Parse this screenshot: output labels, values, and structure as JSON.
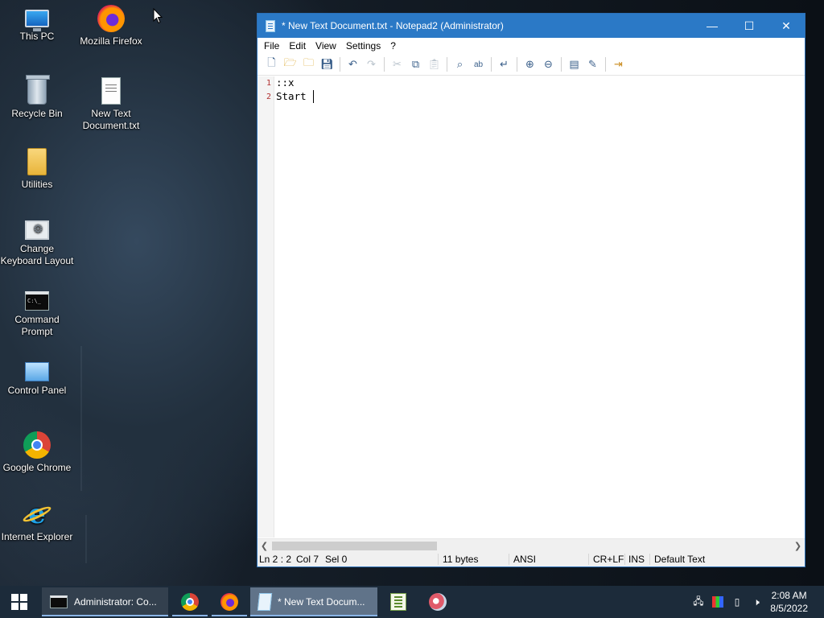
{
  "desktop": {
    "icons": [
      {
        "label": "This PC",
        "icon": "this-pc-icon"
      },
      {
        "label": "Mozilla Firefox",
        "icon": "firefox-icon"
      },
      {
        "label": "Recycle Bin",
        "icon": "recycle-bin-icon"
      },
      {
        "label": "New Text Document.txt",
        "icon": "text-file-icon"
      },
      {
        "label": "Utilities",
        "icon": "folder-icon"
      },
      {
        "label": "Change Keyboard Layout",
        "icon": "keyboard-layout-icon"
      },
      {
        "label": "Command Prompt",
        "icon": "command-prompt-icon"
      },
      {
        "label": "Control Panel",
        "icon": "control-panel-icon"
      },
      {
        "label": "Google Chrome",
        "icon": "chrome-icon"
      },
      {
        "label": "Internet Explorer",
        "icon": "internet-explorer-icon"
      }
    ]
  },
  "window": {
    "title": "* New Text Document.txt - Notepad2 (Administrator)",
    "controls": {
      "minimize": "—",
      "maximize": "☐",
      "close": "✕"
    },
    "menu": [
      "File",
      "Edit",
      "View",
      "Settings",
      "?"
    ],
    "editor": {
      "lines": [
        {
          "number": "1",
          "text": "::x"
        },
        {
          "number": "2",
          "text": "Start "
        }
      ]
    },
    "status": {
      "position": "Ln 2 : 2",
      "column": "Col 7",
      "selection": "Sel 0",
      "size": "11 bytes",
      "encoding": "ANSI",
      "line_endings": "CR+LF",
      "mode": "INS",
      "scheme": "Default Text"
    }
  },
  "taskbar": {
    "items": [
      {
        "label": "Administrator: Co...",
        "icon": "command-prompt-icon"
      },
      {
        "label": "",
        "icon": "chrome-icon"
      },
      {
        "label": "",
        "icon": "firefox-icon"
      },
      {
        "label": "* New Text Docum...",
        "icon": "notepad2-icon"
      },
      {
        "label": "",
        "icon": "notepad-plus-icon"
      },
      {
        "label": "",
        "icon": "paint-icon"
      }
    ],
    "clock": {
      "time": "2:08 AM",
      "date": "8/5/2022"
    }
  }
}
